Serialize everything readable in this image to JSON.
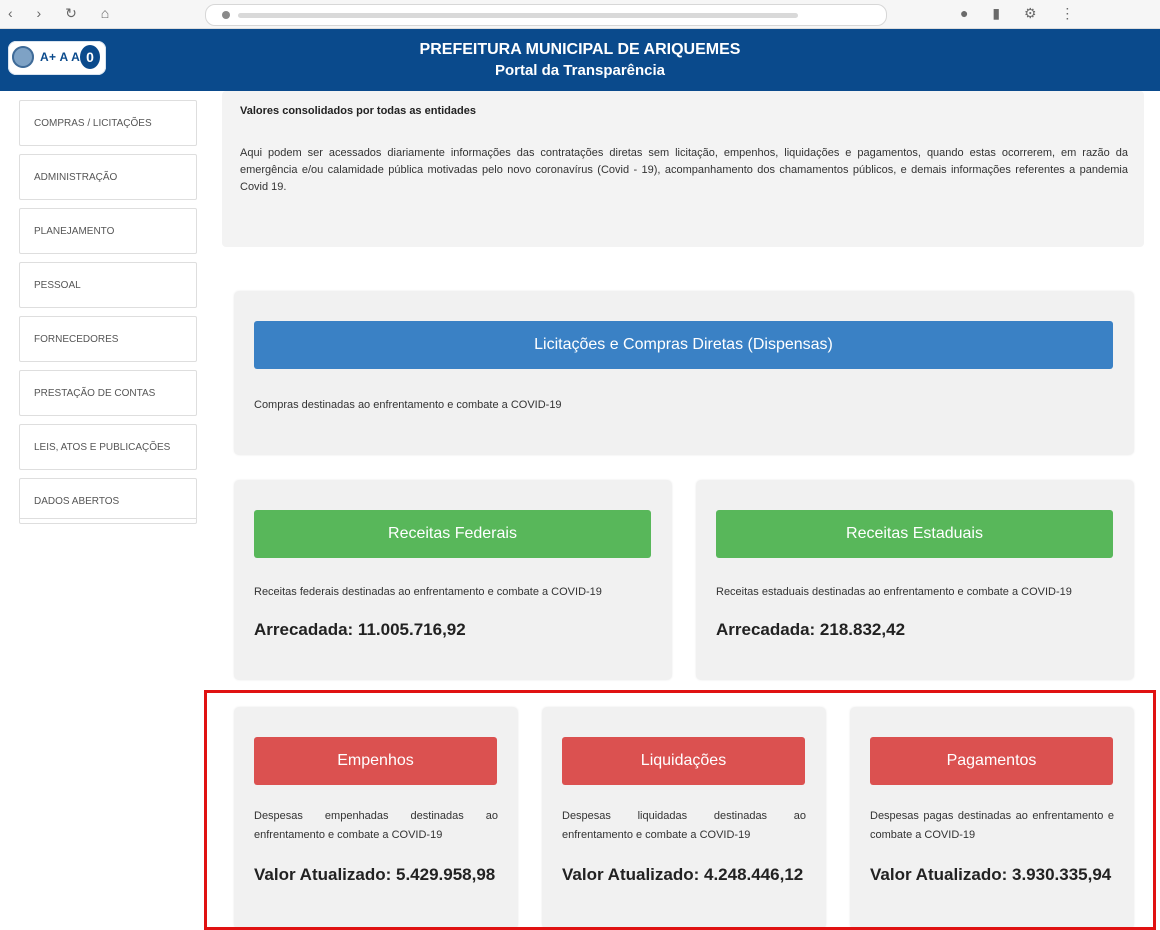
{
  "browser": {
    "nav_icons": [
      "back-icon",
      "forward-icon",
      "refresh-icon",
      "home-icon"
    ],
    "url_icons": [
      "lock-icon"
    ],
    "tool_icons": [
      "profile-icon",
      "extension-icon",
      "settings-icon",
      "menu-icon"
    ]
  },
  "header": {
    "title": "PREFEITURA MUNICIPAL DE ARIQUEMES",
    "subtitle": "Portal da Transparência",
    "accessibility": {
      "text": "A+ A A-",
      "contrast": "0"
    },
    "colors": {
      "background": "#0a4a8c",
      "text": "#ffffff"
    }
  },
  "sidebar": {
    "items": [
      {
        "label": "COMPRAS / LICITAÇÕES"
      },
      {
        "label": "ADMINISTRAÇÃO"
      },
      {
        "label": "PLANEJAMENTO"
      },
      {
        "label": "PESSOAL"
      },
      {
        "label": "FORNECEDORES"
      },
      {
        "label": "PRESTAÇÃO DE CONTAS"
      },
      {
        "label": "LEIS, ATOS E PUBLICAÇÕES"
      },
      {
        "label": "DADOS ABERTOS"
      }
    ]
  },
  "intro": {
    "heading": "Valores consolidados por todas as entidades",
    "text": "Aqui podem ser acessados diariamente informações das contratações diretas sem licitação, empenhos, liquidações e pagamentos, quando estas ocorrerem, em razão da emergência e/ou calamidade pública motivadas pelo novo coronavírus (Covid - 19), acompanhamento dos chamamentos públicos, e demais informações referentes a pandemia Covid 19."
  },
  "licitacoes": {
    "button": "Licitações e Compras Diretas (Dispensas)",
    "description": "Compras destinadas ao enfrentamento e combate a COVID-19"
  },
  "receitas": {
    "federal": {
      "button": "Receitas Federais",
      "description": "Receitas federais destinadas ao enfrentamento e combate a COVID-19",
      "amount": "Arrecadada: 11.005.716,92"
    },
    "estadual": {
      "button": "Receitas Estaduais",
      "description": "Receitas estaduais destinadas ao enfrentamento e combate a COVID-19",
      "amount": "Arrecadada: 218.832,42"
    }
  },
  "despesas": {
    "empenhos": {
      "button": "Empenhos",
      "description": "Despesas empenhadas destinadas ao enfrentamento e combate a COVID-19",
      "amount": "Valor Atualizado: 5.429.958,98"
    },
    "liquidacoes": {
      "button": "Liquidações",
      "description": "Despesas liquidadas destinadas ao enfrentamento e combate a COVID-19",
      "amount": "Valor Atualizado: 4.248.446,12"
    },
    "pagamentos": {
      "button": "Pagamentos",
      "description": "Despesas pagas destinadas ao enfrentamento e combate a COVID-19",
      "amount": "Valor Atualizado: 3.930.335,94"
    }
  },
  "colors": {
    "blue_button": "#3a81c5",
    "green_button": "#58b75a",
    "red_button": "#db5150",
    "highlight_border": "#e01212"
  }
}
